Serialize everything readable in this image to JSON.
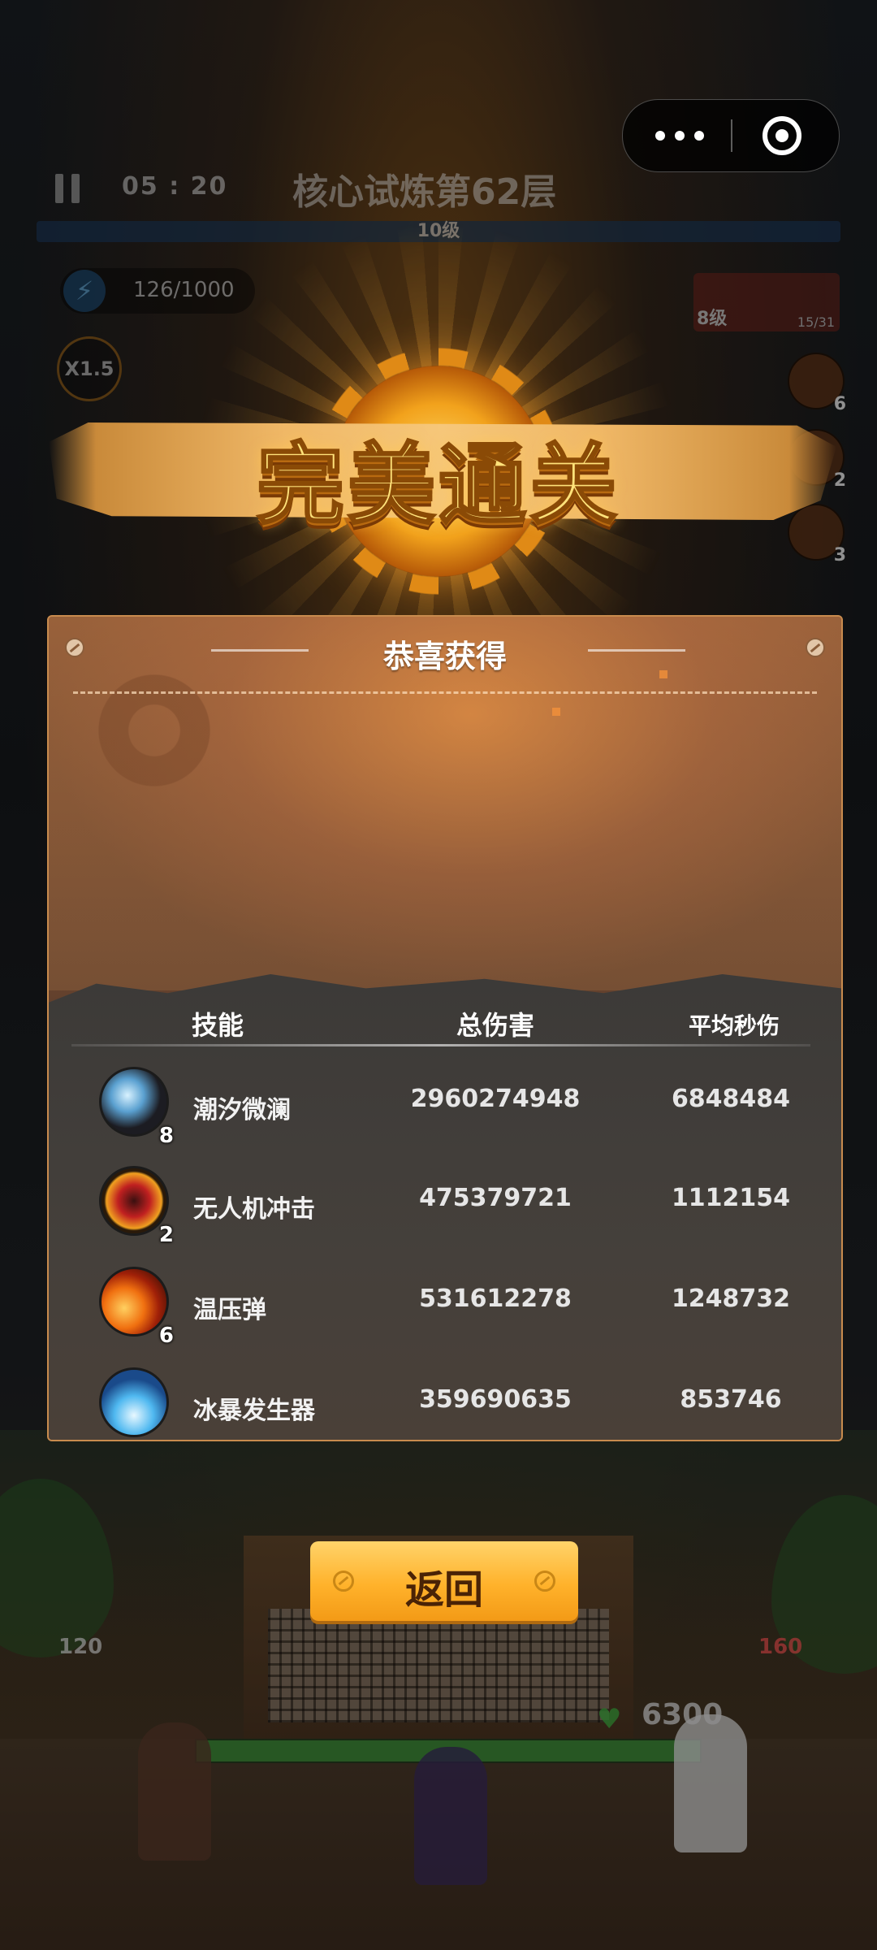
{
  "hud": {
    "timer": "05 : 20",
    "stage_title": "核心试炼第62层",
    "level": "10级",
    "energy": "126/1000",
    "speed": "X1.5",
    "weapon_level": "8级",
    "weapon_count": "15/31",
    "skill_counts": [
      "6",
      "2",
      "3"
    ]
  },
  "banner": {
    "text": "完美通关"
  },
  "panel": {
    "title": "恭喜获得",
    "columns": [
      "技能",
      "总伤害",
      "平均秒伤"
    ],
    "rows": [
      {
        "icon": "tidal-spear-icon",
        "level": "8",
        "name": "潮汐微澜",
        "total": "2960274948",
        "avg": "6848484"
      },
      {
        "icon": "drone-strike-icon",
        "level": "2",
        "name": "无人机冲击",
        "total": "475379721",
        "avg": "1112154"
      },
      {
        "icon": "thermobaric-shell-icon",
        "level": "6",
        "name": "温压弹",
        "total": "531612278",
        "avg": "1248732"
      },
      {
        "icon": "ice-storm-icon",
        "level": "",
        "name": "冰暴发生器",
        "total": "359690635",
        "avg": "853746"
      }
    ]
  },
  "button": {
    "return": "返回"
  },
  "scene": {
    "stat_left": "120",
    "stat_right": "160",
    "hp": "6300"
  },
  "colors": {
    "accent": "#ffb22b",
    "banner": "#ffe27a",
    "panel": "#8f5a34"
  }
}
